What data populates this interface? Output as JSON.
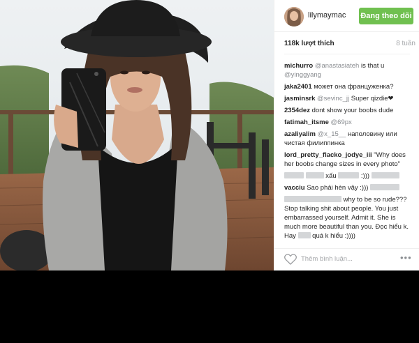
{
  "post": {
    "photo": {
      "description_icon": "photo-icon"
    },
    "header": {
      "username": "lilymaymac",
      "follow_label": "Đang theo dõi"
    },
    "likes": "118k lượt thích",
    "time": "8 tuần",
    "comments": [
      {
        "user": "michurro",
        "mention": "@anastasiateh",
        "text": " is that u ",
        "mention2": "@yinggyang"
      },
      {
        "user": "jaka2401",
        "text": " может она француженка?"
      },
      {
        "user": "jasminsrk",
        "mention": "@sevinc_jj",
        "text": " Super qizdie❤"
      },
      {
        "user": "2354dez",
        "text": " dont show your boobs dude"
      },
      {
        "user": "fatimah_itsme",
        "mention": "@69px"
      },
      {
        "user": "azaliyalim",
        "mention": "@x_15__",
        "text": " наполовину или чистая филиппинка"
      },
      {
        "user": "lord_pretty_flacko_jodye_iii",
        "text": " \"Why does her boobs change sizes in every photo\""
      },
      {
        "text": "xấu",
        "text2": " :)))"
      },
      {
        "user": "vacciu",
        "text": " Sao phải hèn vậy :)))"
      },
      {
        "text": " why to be so rude???",
        "text2": "Stop talking shit about people. You just embarrassed yourself. Admit it. She is much more beautiful than you. Đọc hiểu k. Hay",
        "text3": " quá k hiểu :))))"
      }
    ],
    "add_comment_placeholder": "Thêm bình luận...",
    "more_icon_label": "•••"
  },
  "colors": {
    "follow_button": "#70c050",
    "text_dark": "#262626",
    "text_muted": "#a5a7aa",
    "mention": "#8a8d91"
  }
}
